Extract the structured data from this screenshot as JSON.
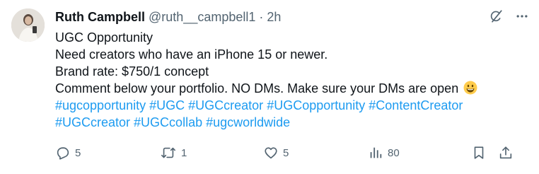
{
  "author": {
    "name": "Ruth Campbell",
    "handle": "@ruth__campbell1",
    "separator": "·",
    "time": "2h"
  },
  "body": {
    "lines": [
      "UGC Opportunity",
      "Need creators who have an iPhone 15 or newer.",
      "Brand rate: $750/1 concept",
      "Comment below your portfolio. NO DMs. Make sure your DMs are open"
    ],
    "emoji": "grinning-face-emoji",
    "hashtags_line1": [
      "#ugcopportunity",
      "#UGC",
      "#UGCcreator",
      "#UGCopportunity",
      "#ContentCreator"
    ],
    "hashtags_line2": [
      "#UGCcreator",
      "#UGCcollab",
      "#ugcworldwide"
    ]
  },
  "header_icons": [
    "grok-icon",
    "more-icon"
  ],
  "actions": {
    "replies": "5",
    "reposts": "1",
    "likes": "5",
    "views": "80"
  },
  "colors": {
    "text": "#0f1419",
    "muted": "#536471",
    "link": "#1d9bf0"
  }
}
